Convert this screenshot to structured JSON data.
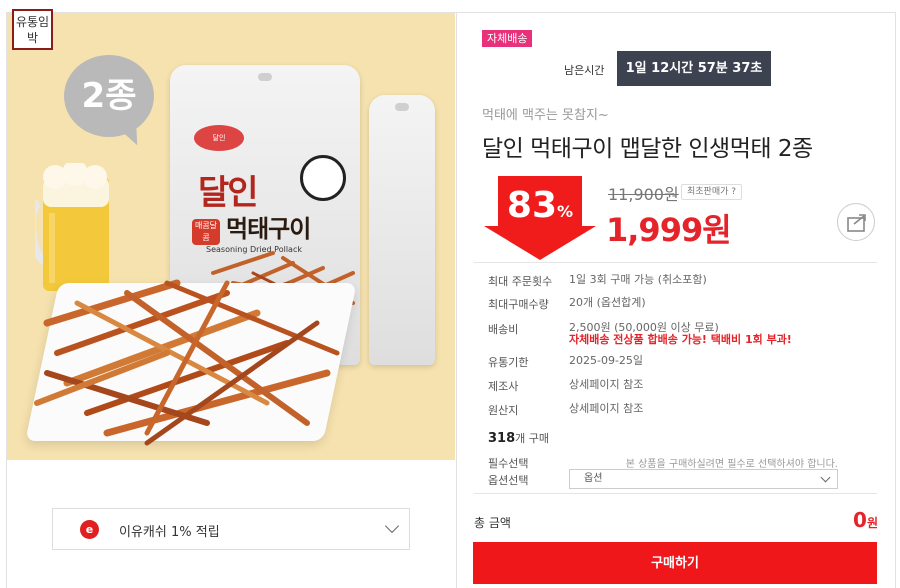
{
  "image_panel": {
    "urgent_badge": "유통임박",
    "count_bubble": "2종",
    "package": {
      "brand_logo": "달인",
      "spicy_tag": "매콤달콤",
      "title_main": "달인",
      "title_sub": "먹태구이",
      "english": "Seasoning Dried Pollack"
    }
  },
  "cashback": {
    "icon": "e",
    "text": "이유캐쉬 1% 적립"
  },
  "product": {
    "shipping_badge": "자체배송",
    "remaining_label": "남은시간",
    "timer": "1일 12시간 57분 37초",
    "subtitle": "먹태에 맥주는 못참지~",
    "title": "달인 먹태구이 맵달한 인생먹태 2종",
    "discount": "83",
    "discount_unit": "%",
    "original_price": "11,900원",
    "lowest_price_badge": "최초판매가 ?",
    "price": "1,999원",
    "info": [
      {
        "label": "최대 주문횟수",
        "value": "1일 3회 구매 가능 (취소포함)"
      },
      {
        "label": "최대구매수량",
        "value": "20개 (옵션합계)"
      },
      {
        "label": "배송비",
        "value": "2,500원 (50,000원 이상 무료)",
        "note": "자체배송 전상품 합배송 가능! 택배비 1회 부과!"
      },
      {
        "label": "유통기한",
        "value": "2025-09-25일"
      },
      {
        "label": "제조사",
        "value": "상세페이지 참조"
      },
      {
        "label": "원산지",
        "value": "상세페이지 참조"
      }
    ],
    "buy_count": "318",
    "buy_count_unit": "개 구매",
    "required_label": "필수선택",
    "required_note": "본 상품을 구매하실려면 필수로 선택하셔야 합니다.",
    "option_label": "옵션선택",
    "option_value": "옵션",
    "total_label": "총 금액",
    "total_value": "0",
    "total_unit": "원",
    "buy_button": "구매하기"
  },
  "colors": {
    "accent_red": "#e4242a",
    "buy_button": "#f0171b",
    "timer_bg": "#3c4250",
    "badge_pink": "#e8317a",
    "image_bg": "#f6e2ae"
  }
}
